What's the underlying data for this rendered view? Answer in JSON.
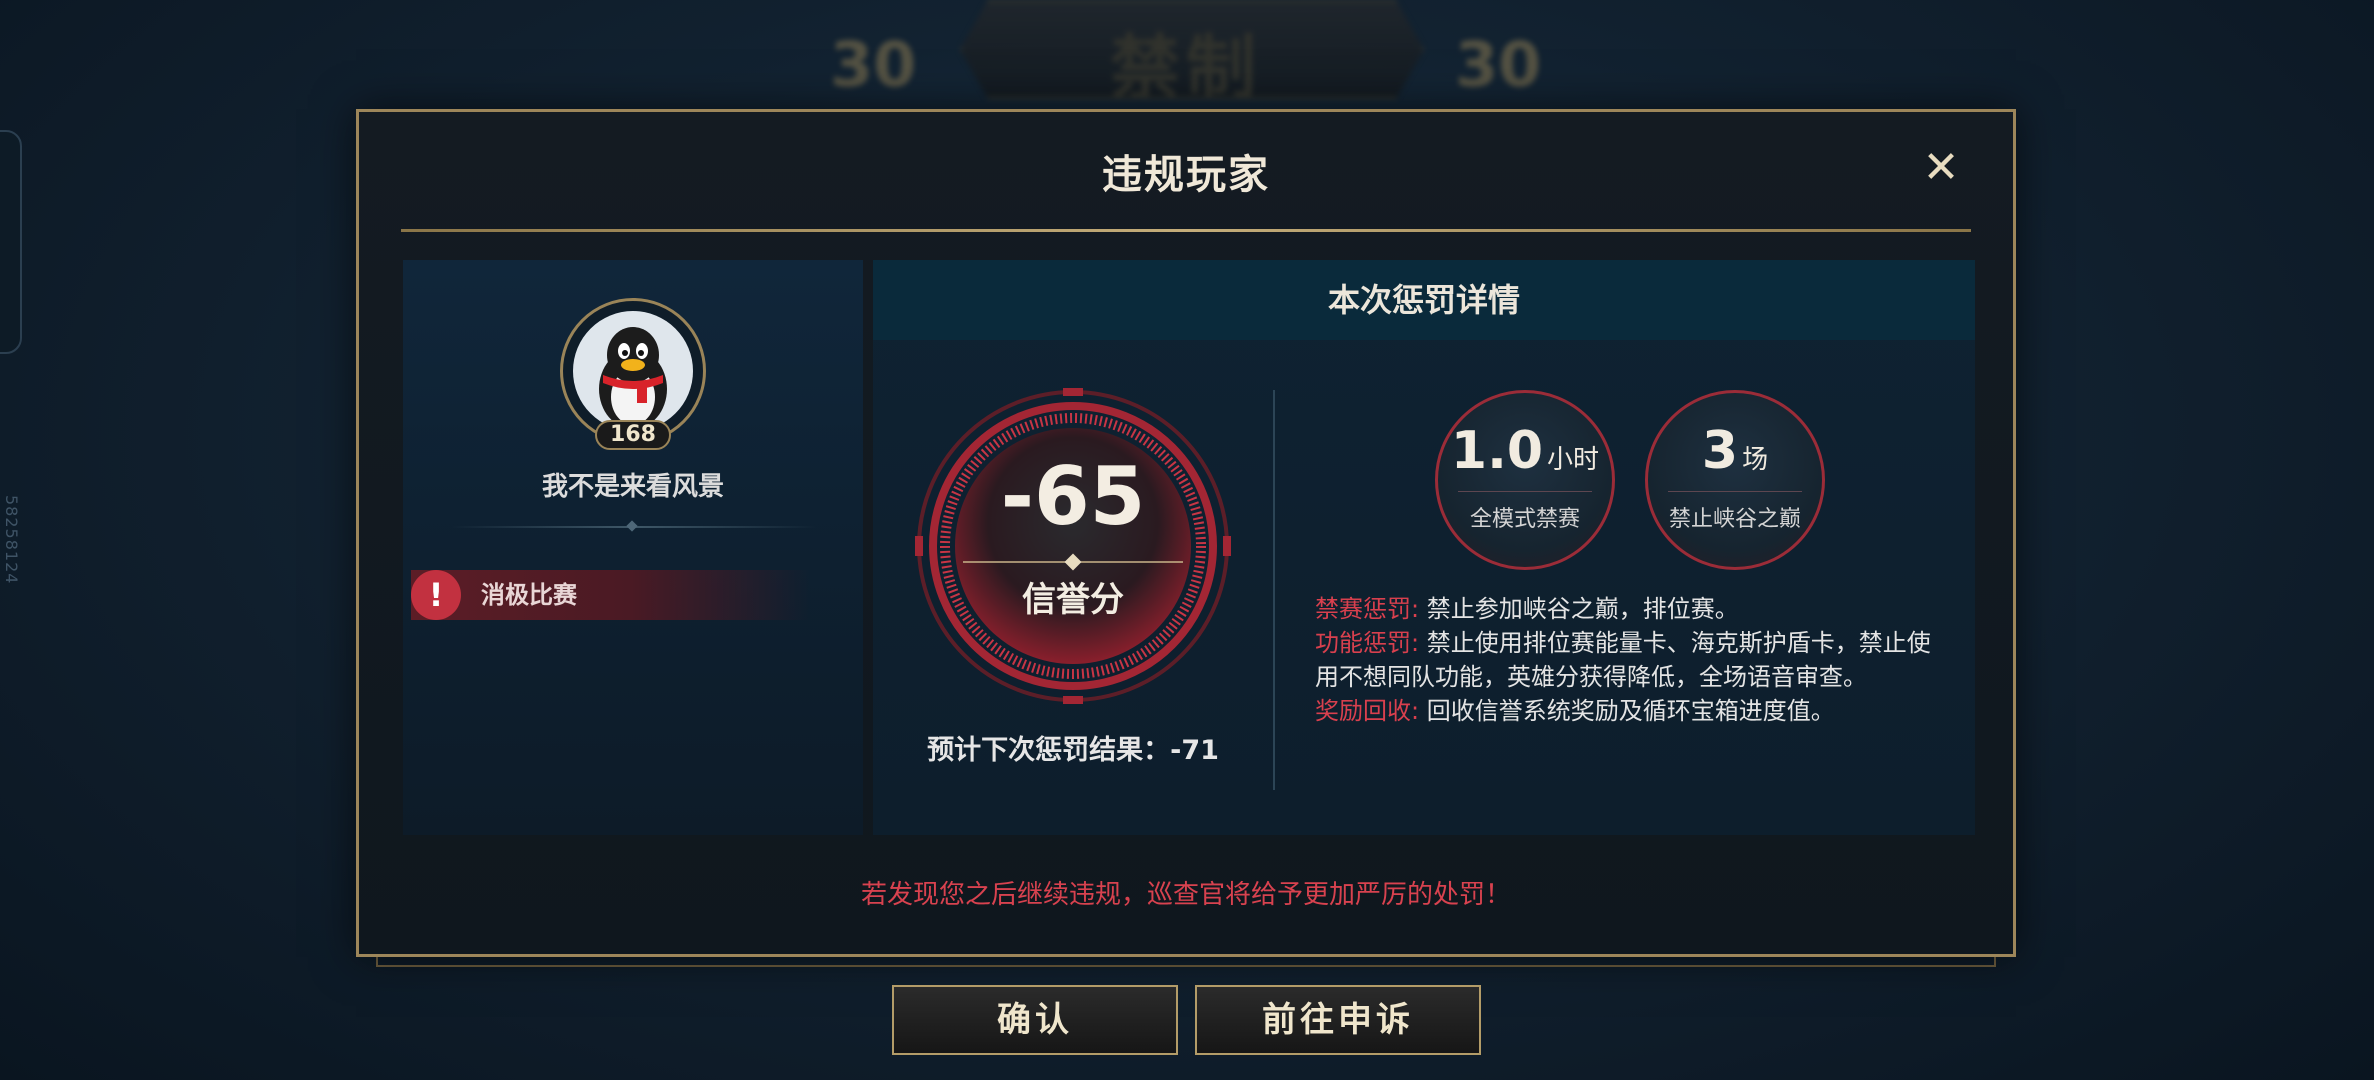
{
  "background": {
    "score_left": "30",
    "score_right": "30",
    "banner_text": "禁制",
    "side_id": "58258124"
  },
  "dialog": {
    "title": "违规玩家",
    "close_icon": "close-icon",
    "warning": "若发现您之后继续违规，巡查官将给予更加严厉的处罚！"
  },
  "player": {
    "avatar_icon": "penguin-avatar",
    "level": "168",
    "name": "我不是来看风景",
    "violation": "消极比赛"
  },
  "penalty": {
    "header": "本次惩罚详情",
    "score_value": "-65",
    "score_label": "信誉分",
    "next_penalty": "预计下次惩罚结果：-71",
    "stats": [
      {
        "value": "1.0",
        "unit": "小时",
        "caption": "全模式禁赛"
      },
      {
        "value": "3",
        "unit": "场",
        "caption": "禁止峡谷之巅"
      }
    ],
    "rules": [
      {
        "key": "禁赛惩罚:",
        "text": "禁止参加峡谷之巅，排位赛。"
      },
      {
        "key": "功能惩罚:",
        "text": "禁止使用排位赛能量卡、海克斯护盾卡，禁止使用不想同队功能，英雄分获得降低，全场语音审查。"
      },
      {
        "key": "奖励回收:",
        "text": "回收信誉系统奖励及循环宝箱进度值。"
      }
    ]
  },
  "buttons": {
    "confirm": "确认",
    "appeal": "前往申诉"
  },
  "colors": {
    "gold_border": "#9d865a",
    "penalty_red": "#d9404e",
    "header_teal": "#0a2a3b"
  }
}
